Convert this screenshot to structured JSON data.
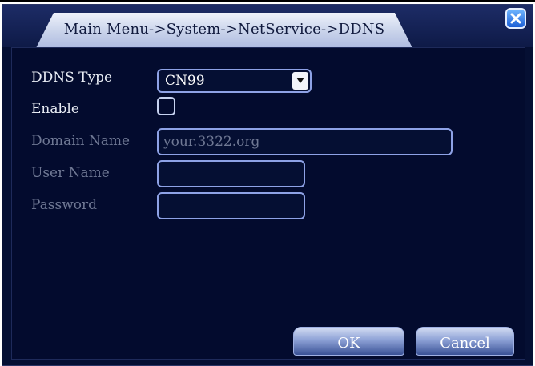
{
  "window": {
    "title": "Main Menu->System->NetService->DDNS"
  },
  "form": {
    "ddns_type_label": "DDNS Type",
    "ddns_type_value": "CN99",
    "enable_label": "Enable",
    "enable_checked": false,
    "domain_name_label": "Domain Name",
    "domain_name_value": "your.3322.org",
    "user_name_label": "User Name",
    "user_name_value": "",
    "password_label": "Password",
    "password_value": ""
  },
  "buttons": {
    "ok_label": "OK",
    "cancel_label": "Cancel"
  },
  "colors": {
    "background": "#030b2e",
    "field_border": "#8ea2e6",
    "label_active": "#e8ecf4",
    "label_disabled": "#6f7894"
  }
}
